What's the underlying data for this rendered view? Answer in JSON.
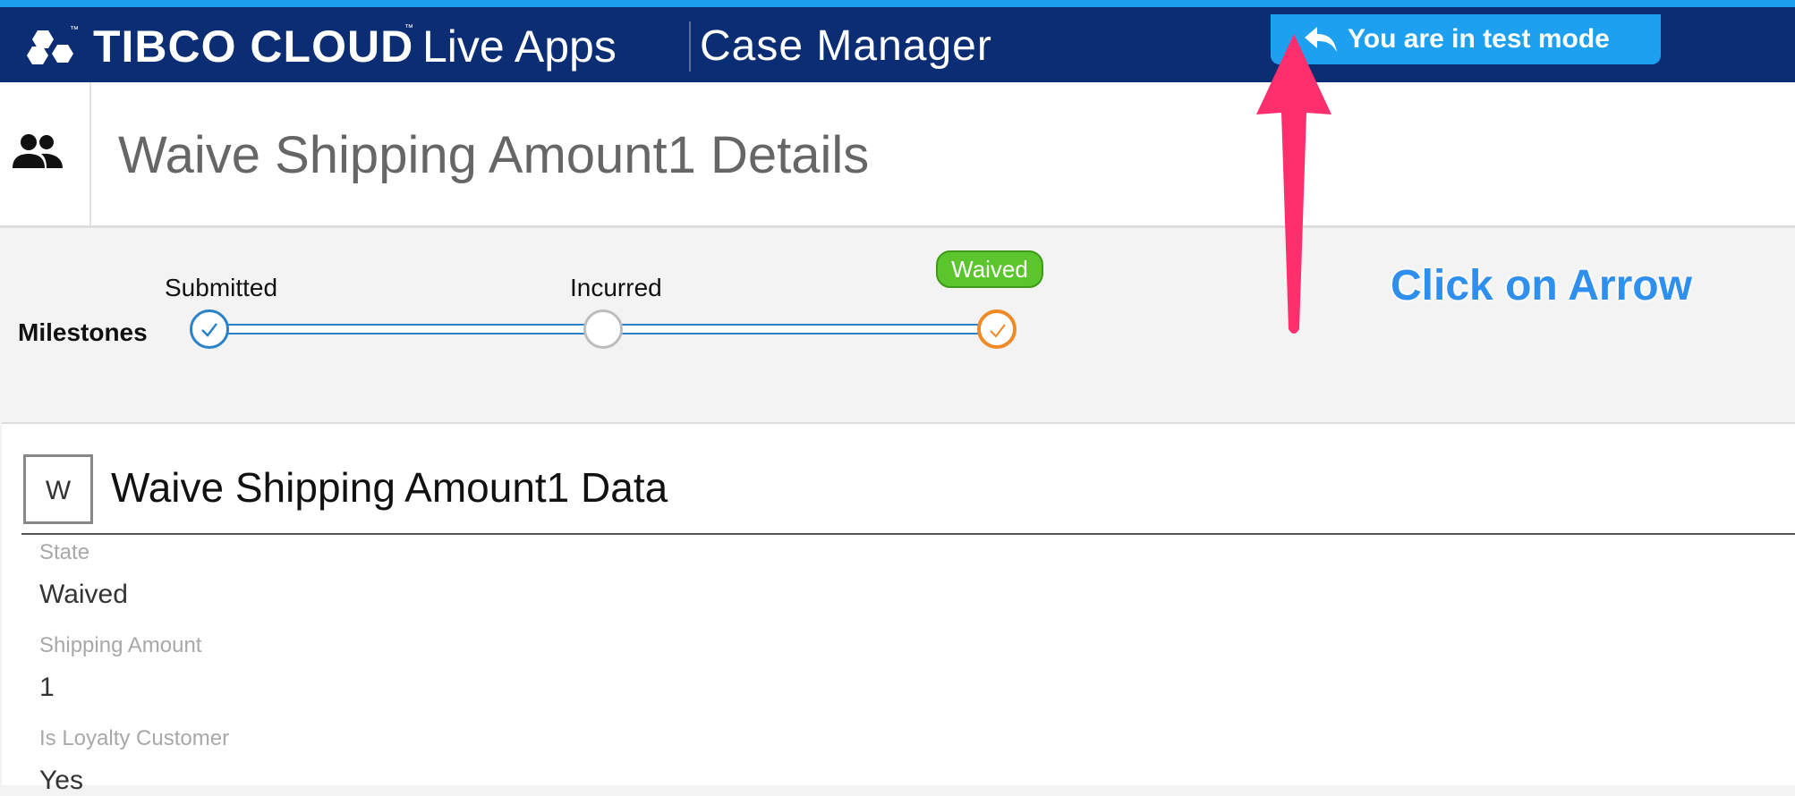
{
  "header": {
    "brand": "TIBCO CLOUD",
    "trademark": "™",
    "product": "Live Apps",
    "app_title": "Case Manager",
    "test_mode_label": "You are in test mode"
  },
  "titlebar": {
    "title": "Waive Shipping Amount1 Details"
  },
  "milestones": {
    "label": "Milestones",
    "items": [
      {
        "label": "Submitted",
        "status": "done"
      },
      {
        "label": "Incurred",
        "status": "pending"
      },
      {
        "label": "Waived",
        "status": "current"
      }
    ]
  },
  "annotation": {
    "text": "Click on Arrow"
  },
  "card": {
    "icon_letter": "W",
    "title": "Waive Shipping Amount1 Data",
    "fields": [
      {
        "label": "State",
        "value": "Waived"
      },
      {
        "label": "Shipping Amount",
        "value": "1"
      },
      {
        "label": "Is Loyalty Customer",
        "value": "Yes"
      }
    ]
  },
  "colors": {
    "header_bg": "#0b2d74",
    "accent": "#1ea0f0",
    "milestone_line": "#2a82c9",
    "current_milestone": "#f08a24",
    "badge_green": "#5bc52d",
    "annotation_arrow": "#ff2f6e"
  }
}
